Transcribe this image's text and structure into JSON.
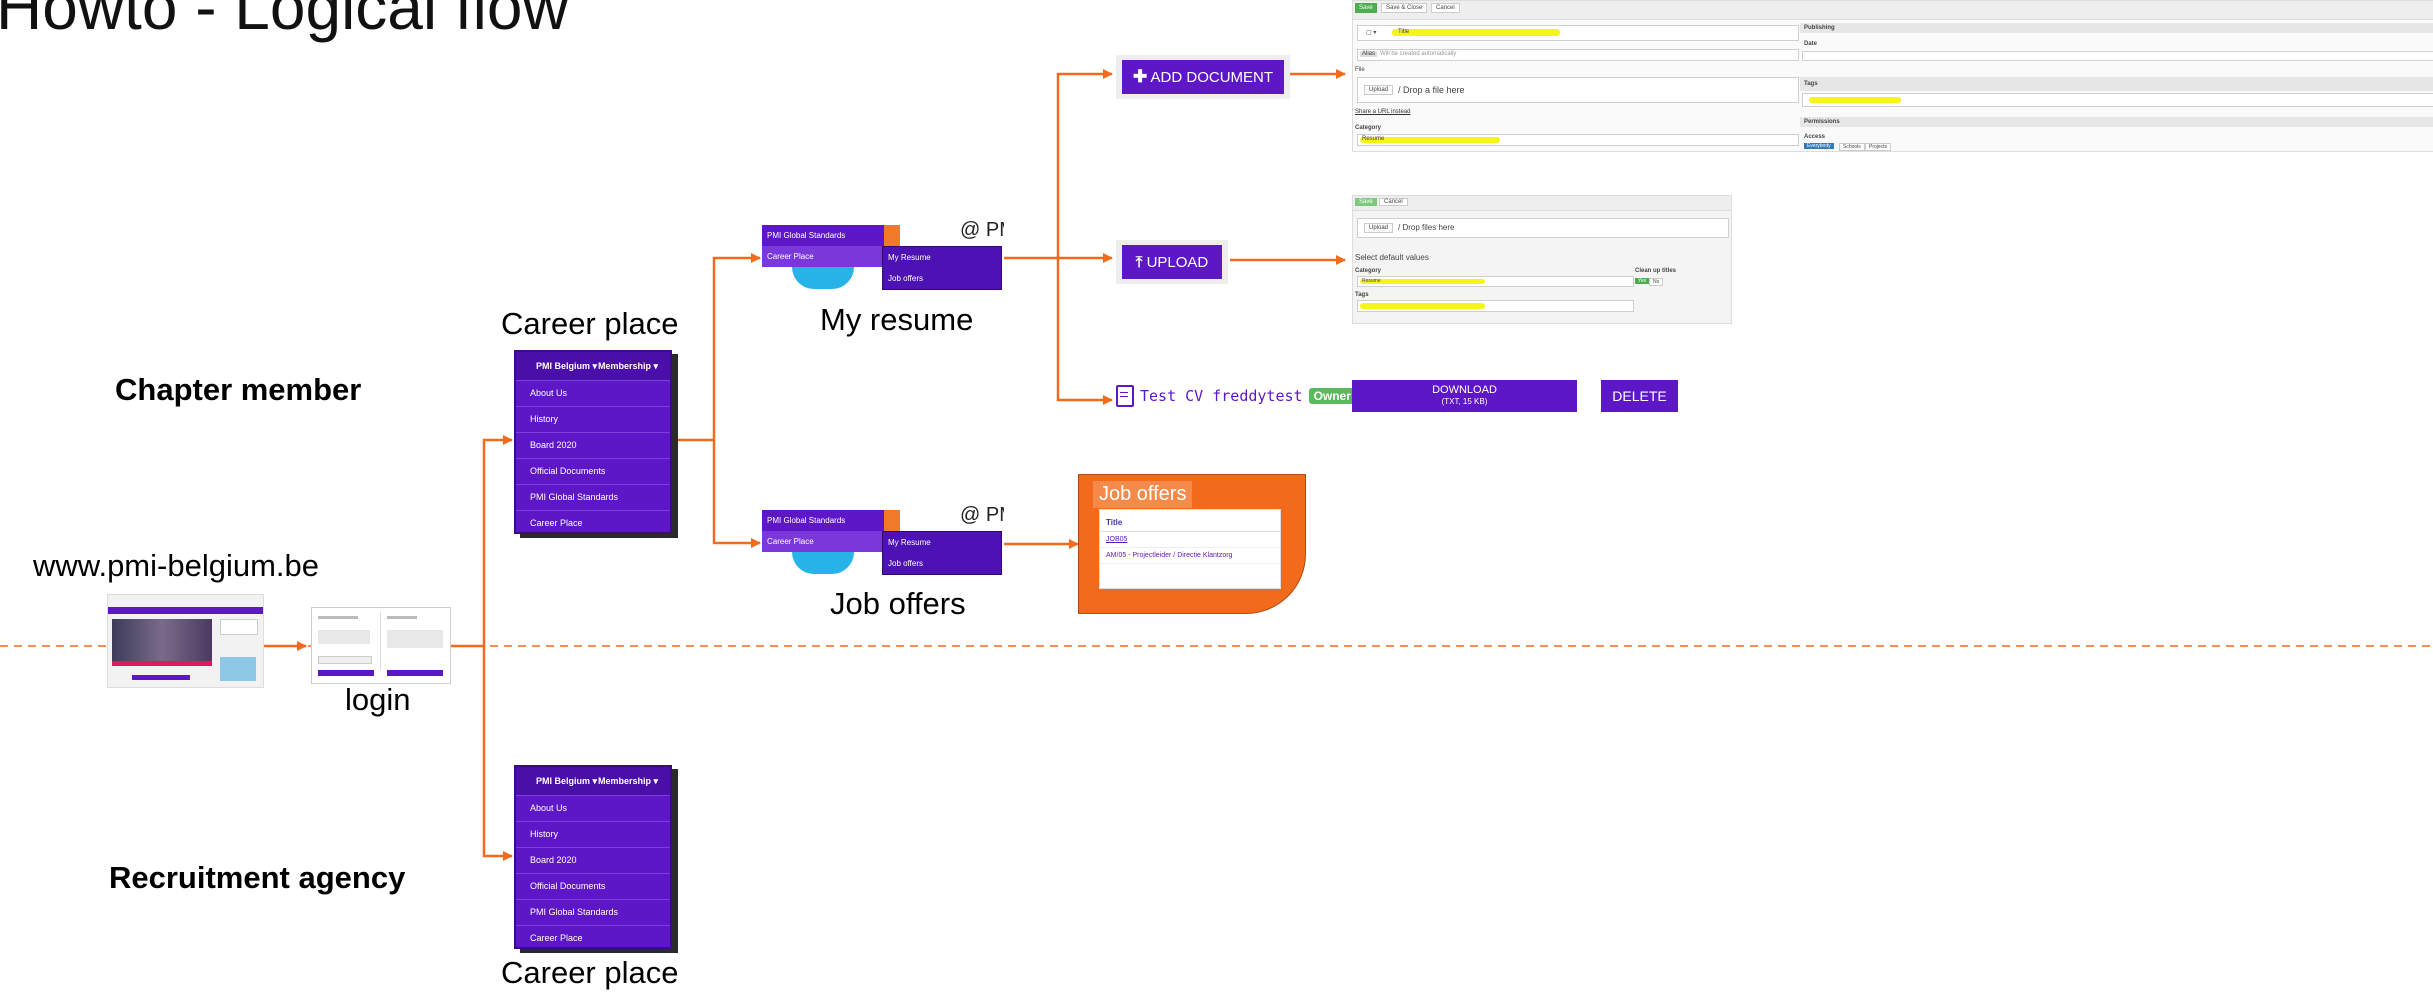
{
  "title": "Howto - Logical flow",
  "roles": {
    "chapter_member": "Chapter member",
    "recruitment_agency": "Recruitment agency"
  },
  "website": "www.pmi-belgium.be",
  "login_label": "login",
  "nodes": {
    "career_place_top": "Career place",
    "career_place_bottom": "Career place",
    "my_resume": "My resume",
    "job_offers": "Job offers"
  },
  "nav_menu": {
    "brand": "PMI Belgium",
    "membership": "Membership",
    "items": [
      "About Us",
      "History",
      "Board 2020",
      "Official Documents",
      "PMI Global Standards",
      "Career Place"
    ]
  },
  "submenu": {
    "left": [
      "PMI Global Standards",
      "Career Place"
    ],
    "right_resume": [
      "My Resume",
      "Job offers"
    ],
    "right_offers": [
      "My Resume",
      "Job offers"
    ],
    "at_label": "@ PM"
  },
  "actions": {
    "add_document": "ADD DOCUMENT",
    "upload": "UPLOAD",
    "file_name": "Test CV freddytest",
    "owner_badge": "Owner",
    "download": "DOWNLOAD",
    "download_sub": "(TXT, 15 KB)",
    "delete": "DELETE"
  },
  "add_doc_form": {
    "toolbar": [
      "Save",
      "Save & Close",
      "Cancel"
    ],
    "title_field": "Title",
    "alias_hint": "Alias",
    "alias_placeholder": "Will be created automatically",
    "file_label": "File",
    "upload_btn": "Upload",
    "drop_text": "/   Drop a file here",
    "url_link": "Share a URL instead",
    "category_label": "Category",
    "category_value": "Resume",
    "publishing": "Publishing",
    "date": "Date",
    "tags": "Tags",
    "permissions": "Permissions",
    "access": "Access",
    "access_options": [
      "Everybody",
      "Schools",
      "Projects"
    ]
  },
  "upload_form": {
    "toolbar": [
      "Save",
      "Cancel"
    ],
    "upload_btn": "Upload",
    "drop_text": "/   Drop files here",
    "default_values": "Select default values",
    "category_label": "Category",
    "category_value": "Resume",
    "cleanup_label": "Clean up titles",
    "cleanup_yes": "Yes",
    "cleanup_no": "No",
    "tags_label": "Tags"
  },
  "job_offers_panel": {
    "title": "Job offers",
    "column": "Title",
    "rows": [
      "JOB05",
      "AM/05 - Projectleider / Directie Klantzorg"
    ]
  },
  "colors": {
    "purple": "#5e17c7",
    "orange_arrow": "#f26a1c",
    "owner_green": "#5cb85c",
    "highlight": "#f5f51a"
  }
}
